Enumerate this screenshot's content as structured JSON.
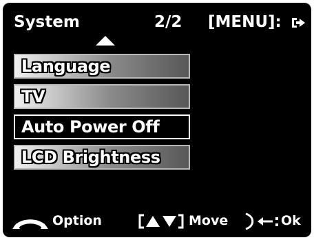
{
  "header": {
    "title": "System",
    "page": "2/2",
    "menu_hint": "[MENU]:",
    "exit_icon": "exit-arrow-icon"
  },
  "menu": {
    "scroll_indicator": "up-arrow-icon",
    "items": [
      {
        "label": "Language",
        "selected": false
      },
      {
        "label": "TV",
        "selected": false
      },
      {
        "label": "Auto Power Off",
        "selected": true
      },
      {
        "label": "LCD Brightness",
        "selected": false
      }
    ]
  },
  "footer": {
    "option_icon": "rocker-option-icon",
    "option_label": "Option",
    "move_icon": "up-down-nav-icon",
    "move_label": "Move",
    "ok_icon": "dial-enter-icon",
    "ok_label": "Ok"
  },
  "colors": {
    "background": "#000000",
    "text": "#ffffff",
    "item_gradient_light": "#efefef",
    "item_gradient_dark": "#585858",
    "item_border": "#b8b8b8"
  }
}
